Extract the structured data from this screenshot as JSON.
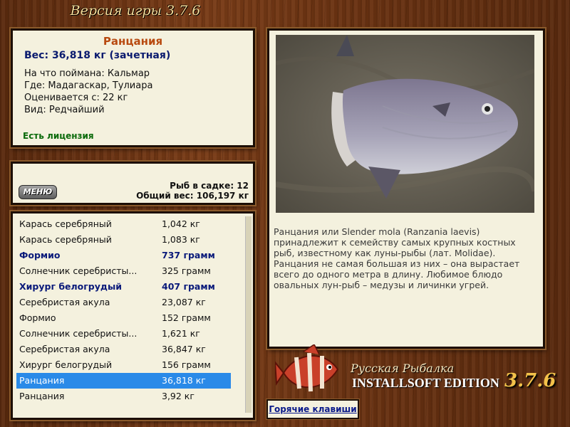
{
  "header": {
    "version_title": "Версия игры 3.7.6"
  },
  "fish_info": {
    "name": "Ранцания",
    "weight_line": "Вес: 36,818 кг (зачетная)",
    "details": [
      "На что поймана: Кальмар",
      "Где: Мадагаскар, Тулиара",
      "Оценивается с: 22 кг",
      "Вид: Редчайший"
    ],
    "license": "Есть лицензия"
  },
  "summary": {
    "menu_label": "МЕНЮ",
    "fish_count": "Рыб в садке: 12",
    "total_weight": "Общий вес: 106,197 кг"
  },
  "catch_list": [
    {
      "name": "Карась серебряный",
      "weight": "1,042 кг",
      "style": "normal"
    },
    {
      "name": "Карась серебряный",
      "weight": "1,083 кг",
      "style": "normal"
    },
    {
      "name": "Формио",
      "weight": "737 грамм",
      "style": "bold"
    },
    {
      "name": "Солнечник серебристы...",
      "weight": "325 грамм",
      "style": "normal"
    },
    {
      "name": "Хирург белогрудый",
      "weight": "407 грамм",
      "style": "bold"
    },
    {
      "name": "Серебристая акула",
      "weight": "23,087 кг",
      "style": "normal"
    },
    {
      "name": "Формио",
      "weight": "152 грамм",
      "style": "normal"
    },
    {
      "name": "Солнечник серебристы...",
      "weight": "1,621 кг",
      "style": "normal"
    },
    {
      "name": "Серебристая акула",
      "weight": "36,847 кг",
      "style": "normal"
    },
    {
      "name": "Хирург белогрудый",
      "weight": "156 грамм",
      "style": "normal"
    },
    {
      "name": "Ранцания",
      "weight": "36,818 кг",
      "style": "selected"
    },
    {
      "name": "Ранцания",
      "weight": "3,92 кг",
      "style": "normal"
    }
  ],
  "description": "Ранцания или Slender mola (Ranzania laevis) принадлежит к семейству самых крупных костных рыб, известному как луны-рыбы (лат. Molidae). Ранцания не самая большая из них – она вырастает всего до одного метра в длину. Любимое блюдо овальных лун-рыб – медузы и личинки угрей.",
  "branding": {
    "line1": "Русская Рыбалка",
    "line2": "INSTALLSOFT EDITION",
    "version": "3.7.6"
  },
  "hotkeys_label": "Горячие клавиши",
  "colors": {
    "selected_row": "#2a8ae8",
    "highlight_text": "#0a1a7a",
    "fish_name": "#b84a10",
    "license": "#0a6a0a"
  }
}
